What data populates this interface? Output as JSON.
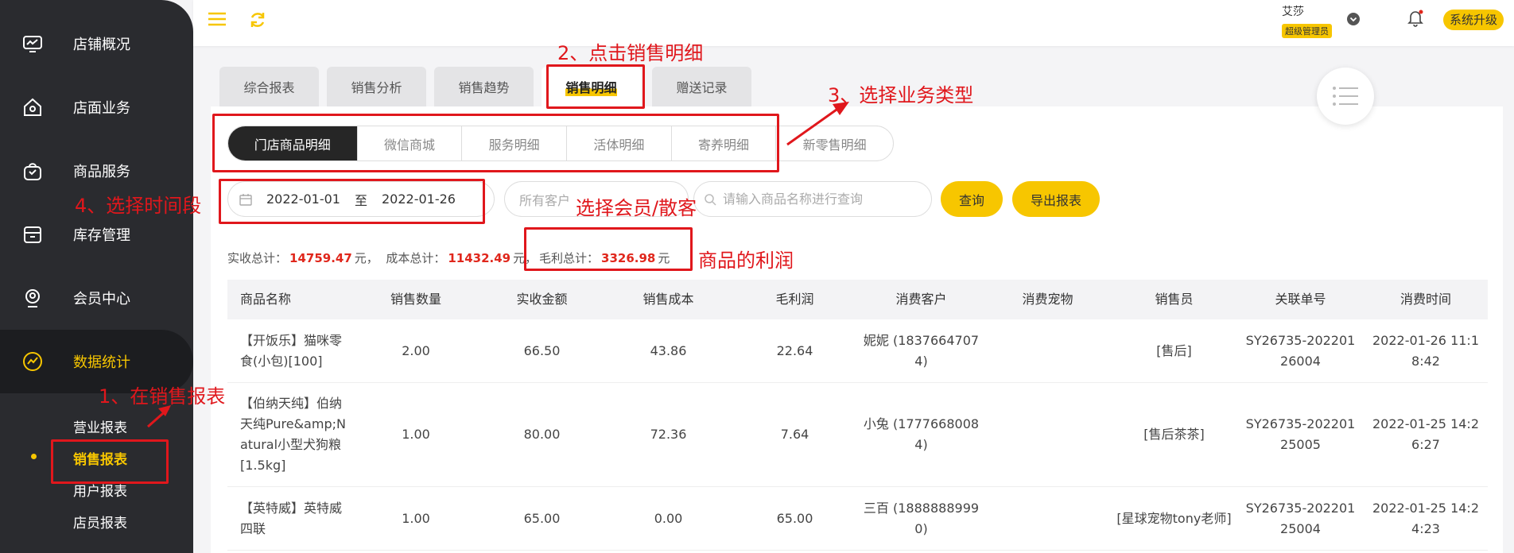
{
  "sidebar": {
    "items": [
      {
        "label": "店铺概况",
        "icon": "monitor-icon"
      },
      {
        "label": "店面业务",
        "icon": "home-icon"
      },
      {
        "label": "商品服务",
        "icon": "bag-icon"
      },
      {
        "label": "库存管理",
        "icon": "inventory-icon"
      },
      {
        "label": "会员中心",
        "icon": "member-icon"
      },
      {
        "label": "数据统计",
        "icon": "chart-icon"
      }
    ],
    "sub_items": [
      "营业报表",
      "销售报表",
      "用户报表",
      "店员报表"
    ]
  },
  "topbar": {
    "user_name": "艾莎",
    "user_role": "超级管理员",
    "upgrade_label": "系统升级"
  },
  "main_tabs": [
    "综合报表",
    "销售分析",
    "销售趋势",
    "销售明细",
    "赠送记录"
  ],
  "sub_tabs": [
    "门店商品明细",
    "微信商城",
    "服务明细",
    "活体明细",
    "寄养明细",
    "新零售明细"
  ],
  "filters": {
    "date_start": "2022-01-01",
    "date_sep": "至",
    "date_end": "2022-01-26",
    "customer_placeholder": "所有客户",
    "search_placeholder": "请输入商品名称进行查询",
    "query_label": "查询",
    "export_label": "导出报表"
  },
  "totals": {
    "received_label": "实收总计：",
    "received_value": "14759.47",
    "cost_label": "成本总计：",
    "cost_value": "11432.49",
    "profit_label": "毛利总计：",
    "profit_value": "3326.98",
    "unit": "元，",
    "unit_plain": "元"
  },
  "table": {
    "columns": [
      "商品名称",
      "销售数量",
      "实收金额",
      "销售成本",
      "毛利润",
      "消费客户",
      "消费宠物",
      "销售员",
      "关联单号",
      "消费时间"
    ],
    "rows": [
      [
        "【开饭乐】猫咪零食(小包)[100]",
        "2.00",
        "66.50",
        "43.86",
        "22.64",
        "妮妮 (18376647074)",
        "",
        "[售后]",
        "SY26735-20220126004",
        "2022-01-26 11:18:42"
      ],
      [
        "【伯纳天纯】伯纳天纯Pure&amp;Natural小型犬狗粮[1.5kg]",
        "1.00",
        "80.00",
        "72.36",
        "7.64",
        "小兔 (17776680084)",
        "",
        "[售后茶茶]",
        "SY26735-20220125005",
        "2022-01-25 14:26:27"
      ],
      [
        "【英特威】英特威四联",
        "1.00",
        "65.00",
        "0.00",
        "65.00",
        "三百 (18888889990)",
        "",
        "[星球宠物tony老师]",
        "SY26735-20220125004",
        "2022-01-25 14:24:23"
      ]
    ]
  },
  "annotations": {
    "step1": "1、在销售报表",
    "step2": "2、点击销售明细",
    "step3": "3、选择业务类型",
    "step4": "4、选择时间段",
    "member": "选择会员/散客",
    "profit": "商品的利润"
  },
  "colors": {
    "accent": "#f7c600",
    "sidebar_bg": "#2a2b2f",
    "annotation": "#e0171c",
    "money": "#e0271c"
  }
}
